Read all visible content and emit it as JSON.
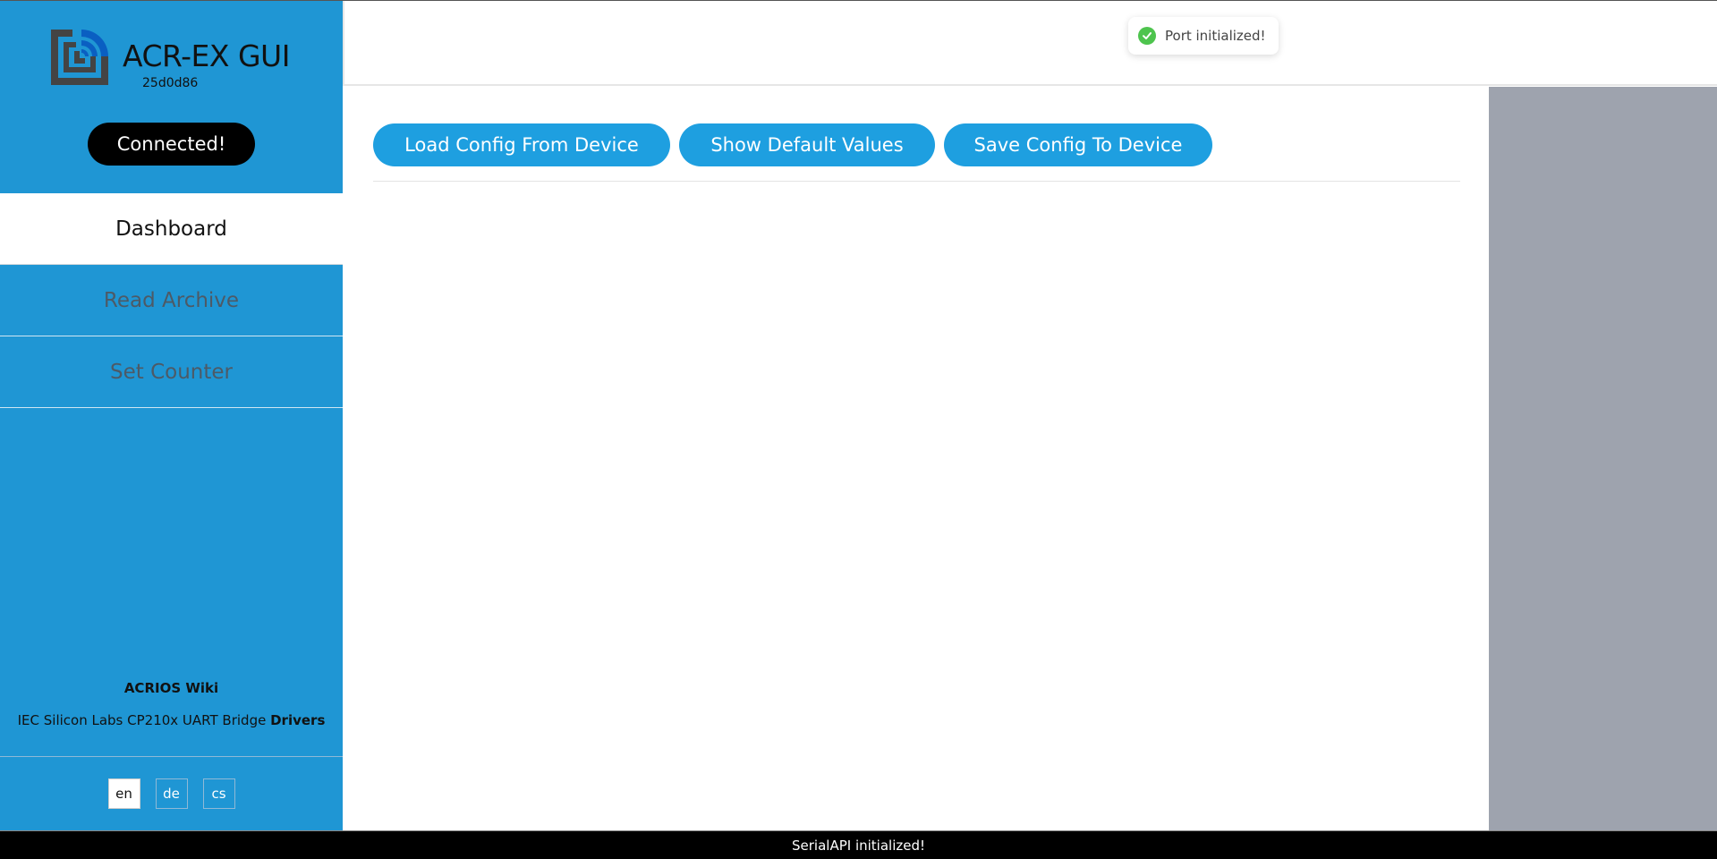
{
  "app": {
    "title": "ACR-EX GUI",
    "version": "25d0d86",
    "connection_status": "Connected!",
    "logo_icon": "acrios-logo-icon"
  },
  "sidebar": {
    "items": [
      {
        "label": "Dashboard",
        "active": true
      },
      {
        "label": "Read Archive",
        "active": false
      },
      {
        "label": "Set Counter",
        "active": false
      }
    ],
    "wiki_link": "ACRIOS Wiki",
    "drivers_prefix": "IEC Silicon Labs CP210x UART Bridge",
    "drivers_link": "Drivers",
    "languages": [
      {
        "code": "en",
        "active": true
      },
      {
        "code": "de",
        "active": false
      },
      {
        "code": "cs",
        "active": false
      }
    ]
  },
  "toast": {
    "icon": "check-circle-icon",
    "message": "Port initialized!",
    "color": "#4ec44e"
  },
  "toolbar": {
    "load_label": "Load Config From Device",
    "defaults_label": "Show Default Values",
    "save_label": "Save Config To Device"
  },
  "footer": {
    "status": "SerialAPI initialized!"
  },
  "colors": {
    "sidebar": "#1f96d4",
    "button": "#1e9fe0",
    "side_panel": "#9ea3ae"
  }
}
